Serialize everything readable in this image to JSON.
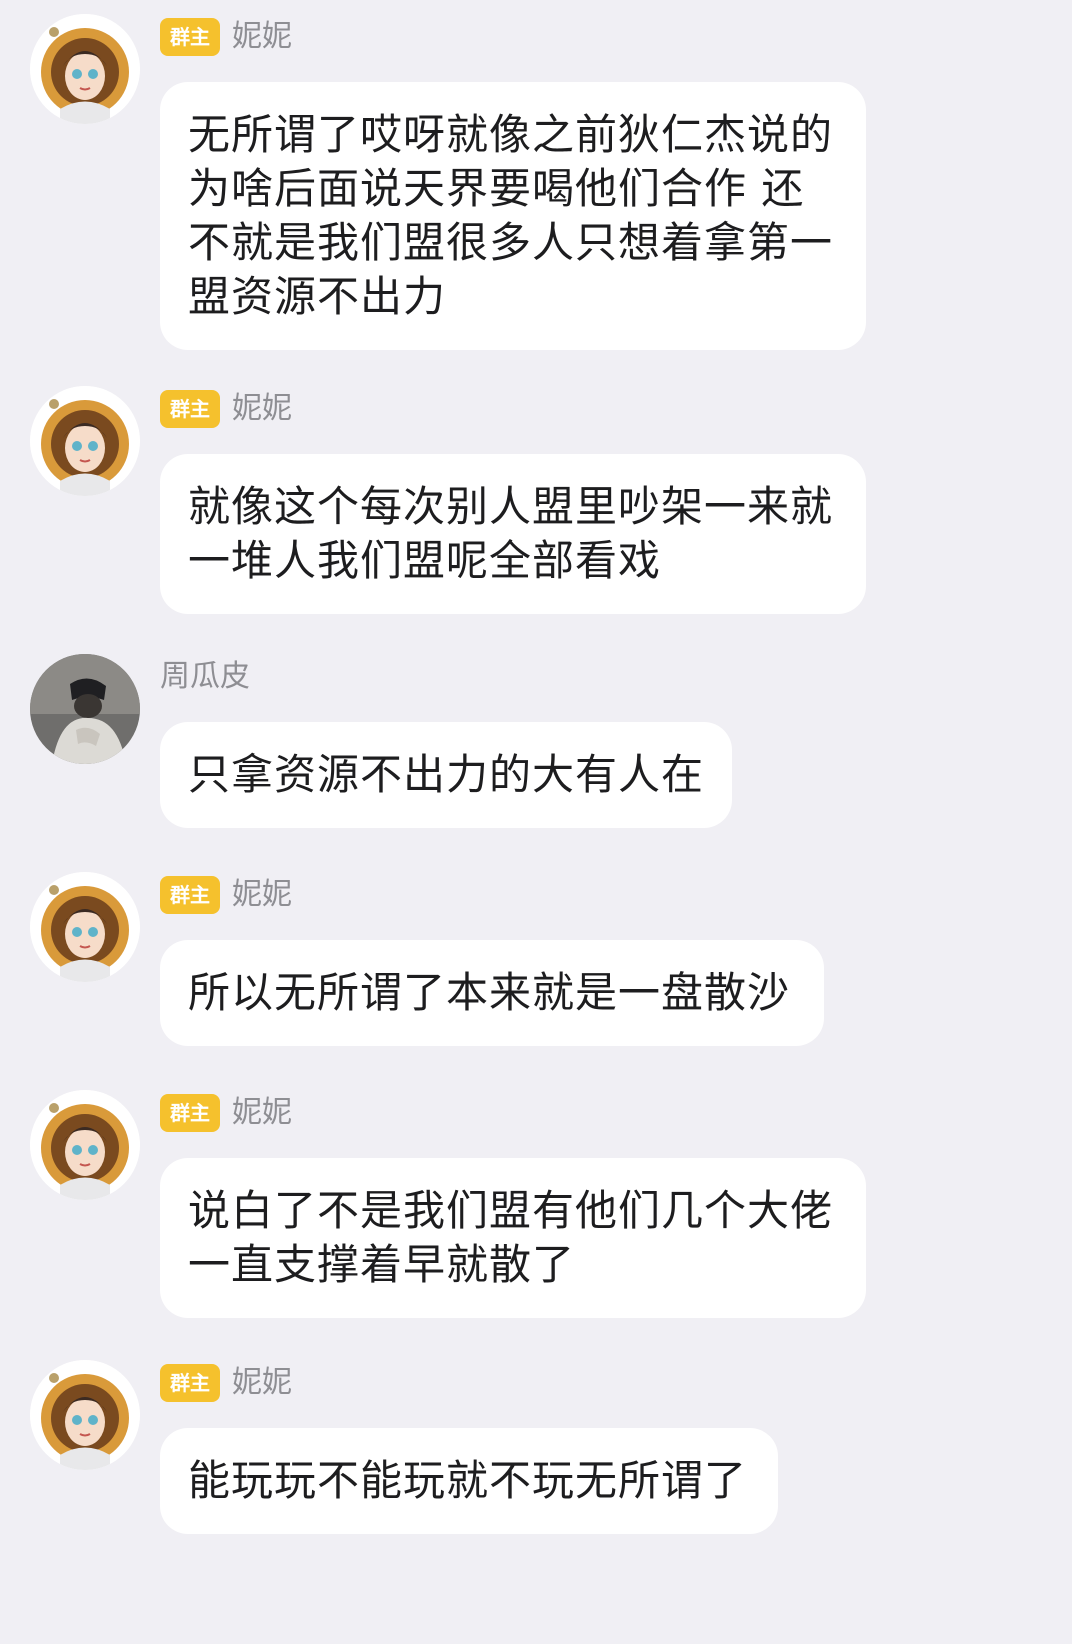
{
  "colors": {
    "background": "#f0eff4",
    "bubble": "#ffffff",
    "badge": "#f5c12d",
    "name": "#8e8e93",
    "text": "#1d1d1f"
  },
  "messages": [
    {
      "avatar": "cartoon-girl-avatar",
      "badge": "群主",
      "name": "妮妮",
      "text": "无所谓了哎呀就像之前狄仁杰说的\n为啥后面说天界要喝他们合作 还\n不就是我们盟很多人只想着拿第一\n盟资源不出力"
    },
    {
      "avatar": "cartoon-girl-avatar",
      "badge": "群主",
      "name": "妮妮",
      "text": "就像这个每次别人盟里吵架一来就\n一堆人我们盟呢全部看戏"
    },
    {
      "avatar": "hooded-person-photo-avatar",
      "badge": "",
      "name": "周瓜皮",
      "text": "只拿资源不出力的大有人在"
    },
    {
      "avatar": "cartoon-girl-avatar",
      "badge": "群主",
      "name": "妮妮",
      "text": "所以无所谓了本来就是一盘散沙"
    },
    {
      "avatar": "cartoon-girl-avatar",
      "badge": "群主",
      "name": "妮妮",
      "text": "说白了不是我们盟有他们几个大佬\n一直支撑着早就散了"
    },
    {
      "avatar": "cartoon-girl-avatar",
      "badge": "群主",
      "name": "妮妮",
      "text": "能玩玩不能玩就不玩无所谓了"
    }
  ]
}
